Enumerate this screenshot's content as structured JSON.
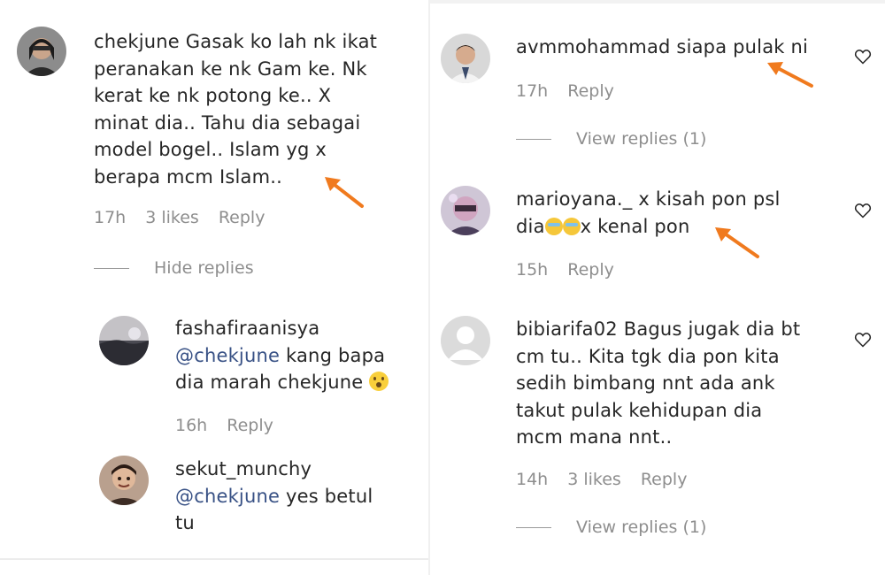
{
  "left": {
    "comment1": {
      "lines": [
        "chekjune Gasak ko lah nk ikat",
        "peranakan ke nk Gam ke. Nk",
        "kerat ke nk potong ke.. X",
        "minat dia.. Tahu dia sebagai",
        "model bogel.. Islam yg x",
        "berapa mcm Islam.."
      ],
      "time": "17h",
      "likes": "3 likes",
      "reply": "Reply",
      "toggle": "Hide replies"
    },
    "reply1": {
      "username": "fashafiraanisya",
      "mention": "@chekjune",
      "line1_rest": " kang bapa",
      "line2": "dia marah chekjune ",
      "time": "16h",
      "reply": "Reply"
    },
    "reply2": {
      "username": "sekut_munchy",
      "mention": "@chekjune",
      "line1_rest": " yes betul",
      "line2": "tu"
    }
  },
  "right": {
    "comment1": {
      "line1": "avmmohammad siapa pulak ni",
      "time": "17h",
      "reply": "Reply",
      "toggle": "View replies (1)"
    },
    "comment2": {
      "line1": "marioyana._ x kisah pon psl",
      "line2_a": "dia",
      "line2_b": "x kenal pon",
      "time": "15h",
      "reply": "Reply"
    },
    "comment3": {
      "lines": [
        "bibiarifa02 Bagus jugak dia bt",
        "cm tu.. Kita tgk dia pon kita",
        "sedih bimbang nnt ada ank",
        "takut pulak kehidupan dia",
        "mcm mana nnt.."
      ],
      "time": "14h",
      "likes": "3 likes",
      "reply": "Reply",
      "toggle": "View replies (1)"
    }
  },
  "colors": {
    "mention": "#385185",
    "meta": "#8e8e8e",
    "arrow": "#f07a1e"
  },
  "icons": [
    "heart-icon",
    "arrow-annotation"
  ]
}
